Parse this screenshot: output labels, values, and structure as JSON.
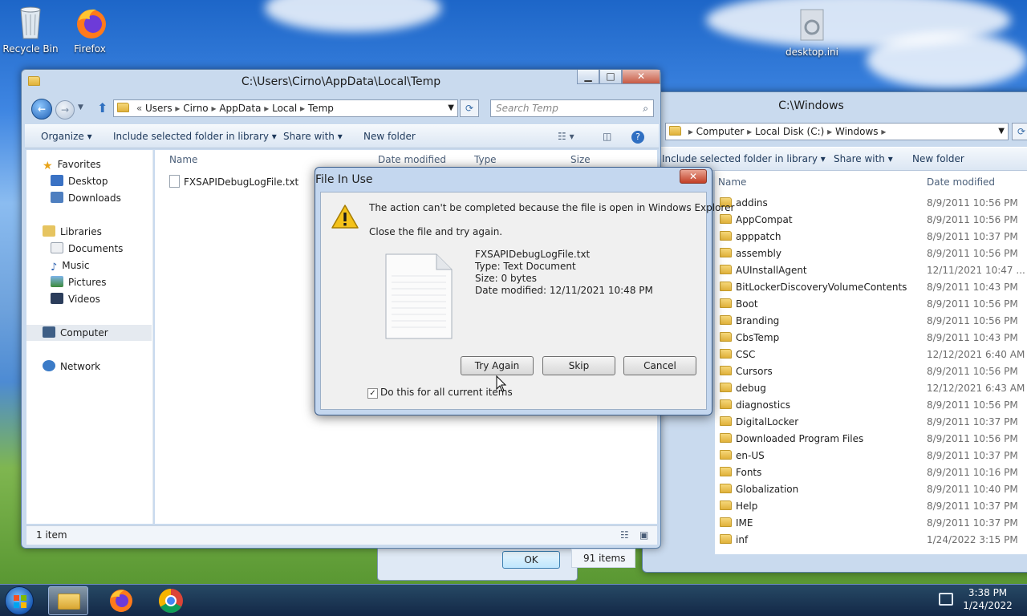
{
  "desktop": {
    "icons": [
      {
        "label": "Recycle Bin"
      },
      {
        "label": "Firefox"
      },
      {
        "label": "desktop.ini"
      }
    ]
  },
  "left_window": {
    "title": "C:\\Users\\Cirno\\AppData\\Local\\Temp",
    "breadcrumb": [
      "Users",
      "Cirno",
      "AppData",
      "Local",
      "Temp"
    ],
    "search_placeholder": "Search Temp",
    "toolbar": {
      "organize": "Organize",
      "include": "Include selected folder in library",
      "share": "Share with",
      "new_folder": "New folder"
    },
    "nav": {
      "favorites": "Favorites",
      "desktop": "Desktop",
      "downloads": "Downloads",
      "libraries": "Libraries",
      "documents": "Documents",
      "music": "Music",
      "pictures": "Pictures",
      "videos": "Videos",
      "computer": "Computer",
      "network": "Network"
    },
    "columns": {
      "name": "Name",
      "date": "Date modified",
      "type": "Type",
      "size": "Size"
    },
    "files": [
      {
        "name": "FXSAPIDebugLogFile.txt"
      }
    ],
    "status": "1 item"
  },
  "right_window": {
    "title": "C:\\Windows",
    "breadcrumb": [
      "Computer",
      "Local Disk (C:)",
      "Windows"
    ],
    "toolbar": {
      "include": "Include selected folder in library",
      "share": "Share with",
      "new_folder": "New folder"
    },
    "columns": {
      "name": "Name",
      "date": "Date modified"
    },
    "rows": [
      {
        "name": "addins",
        "date": "8/9/2011 10:56 PM"
      },
      {
        "name": "AppCompat",
        "date": "8/9/2011 10:56 PM"
      },
      {
        "name": "apppatch",
        "date": "8/9/2011 10:37 PM"
      },
      {
        "name": "assembly",
        "date": "8/9/2011 10:56 PM"
      },
      {
        "name": "AUInstallAgent",
        "date": "12/11/2021 10:47 ..."
      },
      {
        "name": "BitLockerDiscoveryVolumeContents",
        "date": "8/9/2011 10:43 PM"
      },
      {
        "name": "Boot",
        "date": "8/9/2011 10:56 PM"
      },
      {
        "name": "Branding",
        "date": "8/9/2011 10:56 PM"
      },
      {
        "name": "CbsTemp",
        "date": "8/9/2011 10:43 PM"
      },
      {
        "name": "CSC",
        "date": "12/12/2021 6:40 AM"
      },
      {
        "name": "Cursors",
        "date": "8/9/2011 10:56 PM"
      },
      {
        "name": "debug",
        "date": "12/12/2021 6:43 AM"
      },
      {
        "name": "diagnostics",
        "date": "8/9/2011 10:56 PM"
      },
      {
        "name": "DigitalLocker",
        "date": "8/9/2011 10:37 PM"
      },
      {
        "name": "Downloaded Program Files",
        "date": "8/9/2011 10:56 PM"
      },
      {
        "name": "en-US",
        "date": "8/9/2011 10:37 PM"
      },
      {
        "name": "Fonts",
        "date": "8/9/2011 10:16 PM"
      },
      {
        "name": "Globalization",
        "date": "8/9/2011 10:40 PM"
      },
      {
        "name": "Help",
        "date": "8/9/2011 10:37 PM"
      },
      {
        "name": "IME",
        "date": "8/9/2011 10:37 PM"
      },
      {
        "name": "inf",
        "date": "1/24/2022 3:15 PM"
      }
    ],
    "status": "91 items"
  },
  "bg_dialog": {
    "ok": "OK"
  },
  "dialog": {
    "title": "File In Use",
    "message": "The action can't be completed because the file is open in Windows Explorer",
    "instruction": "Close the file and try again.",
    "file_name": "FXSAPIDebugLogFile.txt",
    "file_type": "Type: Text Document",
    "file_size": "Size: 0 bytes",
    "file_modified": "Date modified: 12/11/2021 10:48 PM",
    "try_again": "Try Again",
    "skip": "Skip",
    "cancel": "Cancel",
    "checkbox_label": "Do this for all current items",
    "checkbox_checked": true
  },
  "taskbar": {
    "time": "3:38 PM",
    "date": "1/24/2022"
  },
  "colors": {
    "accent": "#1d66c8",
    "dialog_bg": "#c4d7ef",
    "button_focus": "#3c7fb1"
  }
}
